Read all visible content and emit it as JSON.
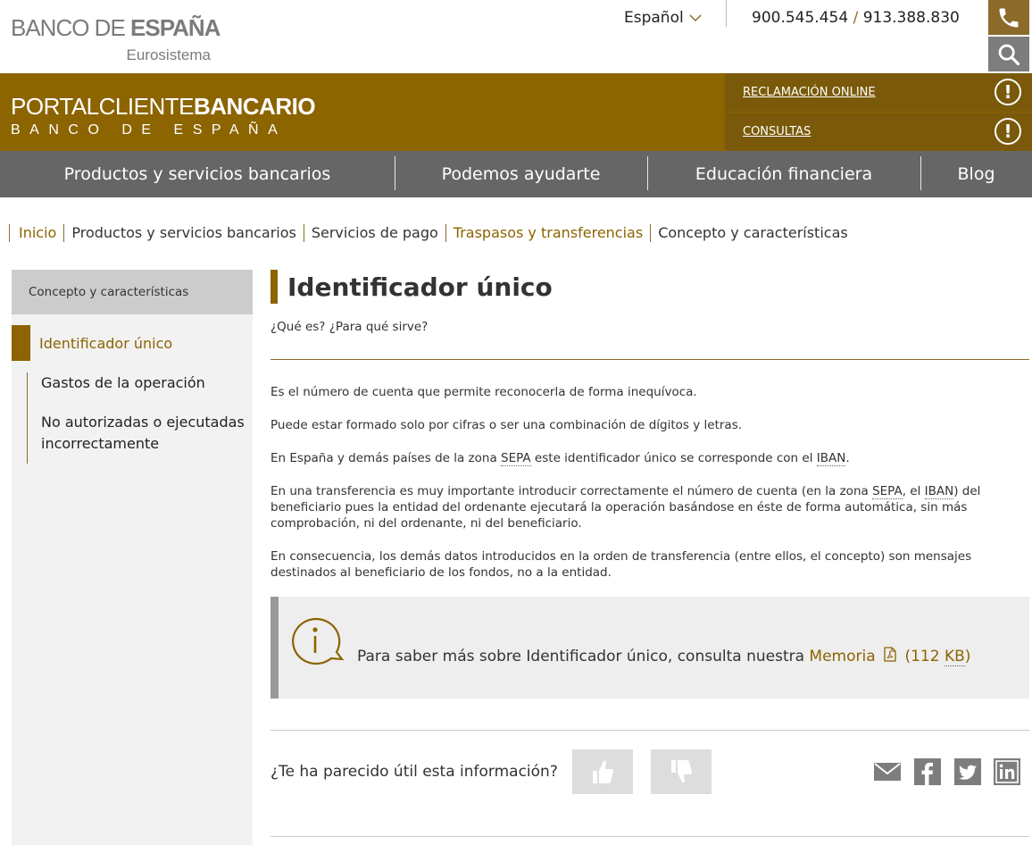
{
  "header": {
    "logo_text_a": "BANCO DE ",
    "logo_text_b": "ESPAÑA",
    "logo_sub": "Eurosistema",
    "language": "Español",
    "phone_1": "900.545.454",
    "phone_sep": "/",
    "phone_2": "913.388.830"
  },
  "portal": {
    "logo_a": "PORTAL",
    "logo_b": "CLIENTE",
    "logo_c": "BANCARIO",
    "logo_line2": "BANCO DE ESPAÑA",
    "link_1": "RECLAMACIÓN ONLINE",
    "link_2": "CONSULTAS",
    "warn_glyph": "!"
  },
  "nav": {
    "items": [
      "Productos y servicios bancarios",
      "Podemos ayudarte",
      "Educación financiera",
      "Blog"
    ]
  },
  "breadcrumb": {
    "items": [
      "Inicio",
      "Productos y servicios bancarios",
      "Servicios de pago",
      "Traspasos y transferencias",
      "Concepto y características"
    ]
  },
  "sidebar": {
    "heading": "Concepto y características",
    "active": "Identificador único",
    "items": [
      "Gastos de la operación",
      "No autorizadas o ejecutadas incorrectamente"
    ]
  },
  "content": {
    "title": "Identificador único",
    "subtitle": "¿Qué es? ¿Para qué sirve?",
    "p1": "Es el número de cuenta que permite reconocerla de forma inequívoca.",
    "p2": "Puede estar formado solo por cifras o ser una combinación de dígitos y letras.",
    "p3_a": "En España y demás países de la zona ",
    "p3_abbr1": "SEPA",
    "p3_b": " este identificador único se corresponde con el ",
    "p3_abbr2": "IBAN",
    "p3_c": ".",
    "p4_a": "En una transferencia es muy importante introducir correctamente el número de cuenta (en la zona ",
    "p4_abbr1": "SEPA",
    "p4_b": ", el ",
    "p4_abbr2": "IBAN",
    "p4_c": ") del beneficiario pues la entidad del ordenante ejecutará la operación basándose en éste de forma automática, sin más comprobación, ni del ordenante, ni del beneficiario.",
    "p5": "En consecuencia, los demás datos introducidos en la orden de transferencia (entre ellos, el concepto) son mensajes destinados al beneficiario de los fondos, no a la entidad."
  },
  "info": {
    "text": "Para saber más sobre Identificador único, consulta nuestra ",
    "link": "Memoria",
    "size_open": "(112 ",
    "size_unit": "KB",
    "size_close": ")"
  },
  "feedback": {
    "question": "¿Te ha parecido útil esta información?"
  },
  "colors": {
    "brand_gold": "#8c6400",
    "nav_gray": "#666666",
    "sidebar_bg": "#f2f2f2"
  }
}
